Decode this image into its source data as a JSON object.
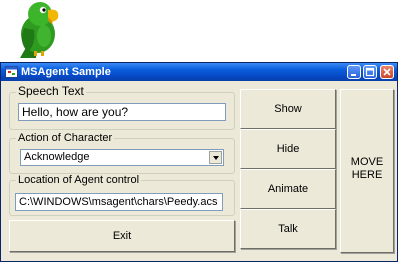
{
  "window": {
    "title": "MSAgent Sample"
  },
  "speech": {
    "legend": "Speech Text",
    "value": "Hello, how are you?"
  },
  "action": {
    "legend": "Action of Character",
    "selected": "Acknowledge"
  },
  "location": {
    "legend": "Location of Agent control",
    "value": "C:\\WINDOWS\\msagent\\chars\\Peedy.acs"
  },
  "buttons": {
    "exit": "Exit",
    "show": "Show",
    "hide": "Hide",
    "animate": "Animate",
    "talk": "Talk",
    "move_line1": "MOVE",
    "move_line2": "HERE"
  },
  "icons": {
    "agent_character": "parrot-icon",
    "app": "app-icon",
    "minimize": "minimize-icon",
    "maximize": "maximize-icon",
    "close": "close-icon",
    "dropdown": "chevron-down-icon"
  },
  "colors": {
    "titlebar": "#0a5fde",
    "window_bg": "#ece9d8",
    "close_button": "#c8452c",
    "parrot": "#2e9a20"
  }
}
